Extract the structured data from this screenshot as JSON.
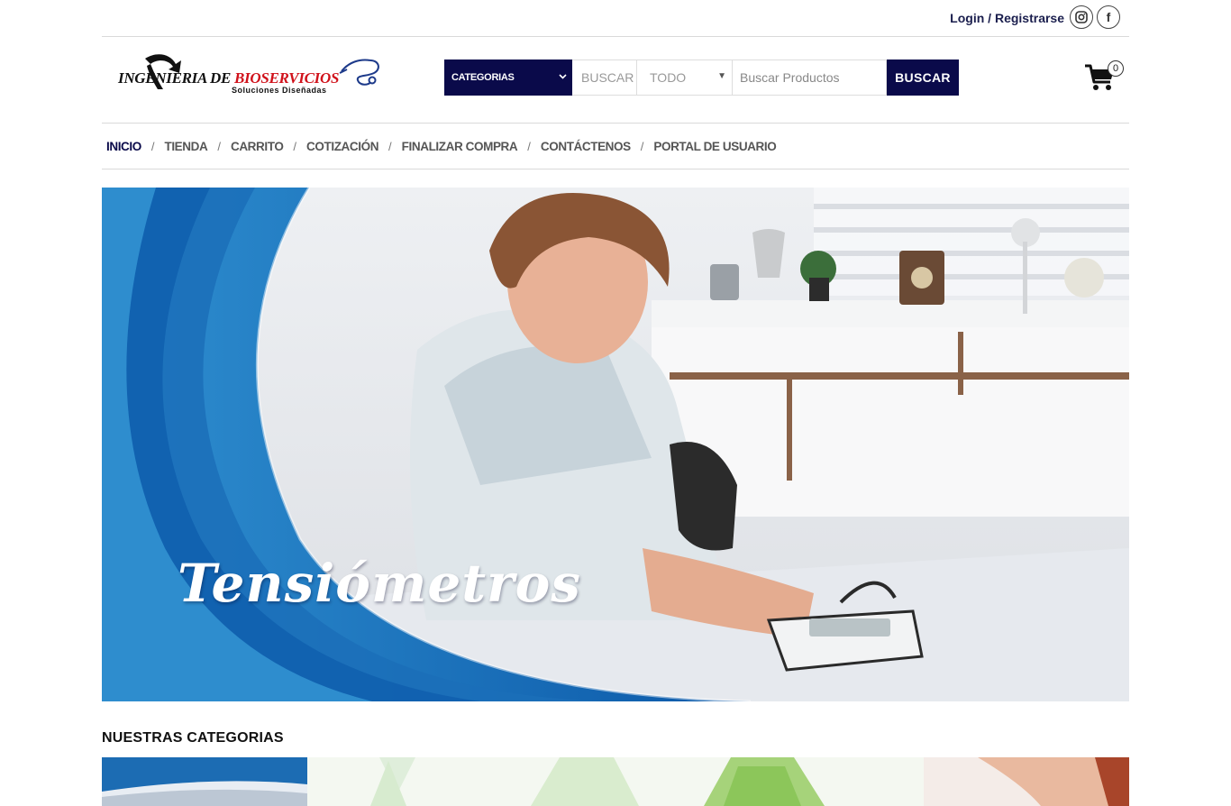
{
  "topbar": {
    "login_label": "Login",
    "separator": " / ",
    "register_label": "Registrarse",
    "social": [
      {
        "icon": "instagram-icon"
      },
      {
        "icon": "facebook-icon",
        "glyph": "f"
      }
    ]
  },
  "header": {
    "logo": {
      "text_part1": "INGENIERIA DE ",
      "text_part2": "BIOSERVICIOS",
      "tagline": "Soluciones Diseñadas"
    },
    "search": {
      "categories_label": "CATEGORIAS",
      "search_label": "BUSCAR",
      "scope_value": "TODO",
      "input_placeholder": "Buscar Productos",
      "button_label": "BUSCAR"
    },
    "cart": {
      "count": "0",
      "icon": "shopping-cart-icon"
    }
  },
  "nav": {
    "items": [
      "INICIO",
      "TIENDA",
      "CARRITO",
      "COTIZACIÓN",
      "FINALIZAR COMPRA",
      "CONTÁCTENOS",
      "PORTAL DE USUARIO"
    ],
    "separator": "/"
  },
  "hero": {
    "title": "Tensiómetros"
  },
  "categories": {
    "heading": "NUESTRAS CATEGORIAS"
  },
  "colors": {
    "brand_navy": "#0a0a4a",
    "logo_red": "#d0121b",
    "hero_blue": "#0f5fae"
  }
}
